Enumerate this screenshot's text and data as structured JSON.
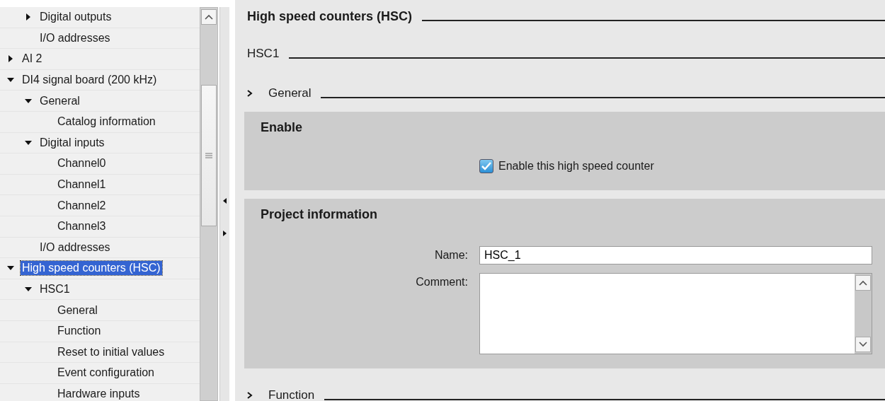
{
  "tree": {
    "partial_branch": [
      {
        "label": "Digital outputs",
        "expanded": false,
        "selected": false
      },
      {
        "label": "I/O addresses",
        "selected": false
      }
    ],
    "items": [
      {
        "label": "AI 2",
        "expanded": false,
        "selected": false
      },
      {
        "label": "DI4 signal board (200 kHz)",
        "expanded": true,
        "selected": false,
        "children": [
          {
            "label": "General",
            "expanded": true,
            "selected": false,
            "children": [
              {
                "label": "Catalog information",
                "selected": false
              }
            ]
          },
          {
            "label": "Digital inputs",
            "expanded": true,
            "selected": false,
            "children": [
              {
                "label": "Channel0",
                "selected": false
              },
              {
                "label": "Channel1",
                "selected": false
              },
              {
                "label": "Channel2",
                "selected": false
              },
              {
                "label": "Channel3",
                "selected": false
              }
            ]
          },
          {
            "label": "I/O addresses",
            "selected": false
          }
        ]
      },
      {
        "label": "High speed counters (HSC)",
        "expanded": true,
        "selected": true,
        "children": [
          {
            "label": "HSC1",
            "expanded": true,
            "selected": false,
            "children": [
              {
                "label": "General",
                "selected": false
              },
              {
                "label": "Function",
                "selected": false
              },
              {
                "label": "Reset to initial values",
                "selected": false
              },
              {
                "label": "Event configuration",
                "selected": false
              },
              {
                "label": "Hardware inputs",
                "selected": false
              }
            ]
          }
        ]
      }
    ]
  },
  "editor": {
    "heading": "High speed counters (HSC)",
    "subheading": "HSC1",
    "sections": [
      {
        "kind": "group",
        "title": "General"
      },
      {
        "kind": "panel",
        "title": "Enable",
        "checkbox": {
          "label": "Enable this high speed counter",
          "checked": true
        }
      },
      {
        "kind": "panel",
        "title": "Project information",
        "fields": [
          {
            "kind": "line",
            "label": "Name:",
            "value": "HSC_1"
          },
          {
            "kind": "area",
            "label": "Comment:"
          }
        ]
      },
      {
        "kind": "group",
        "title": "Function"
      }
    ]
  }
}
